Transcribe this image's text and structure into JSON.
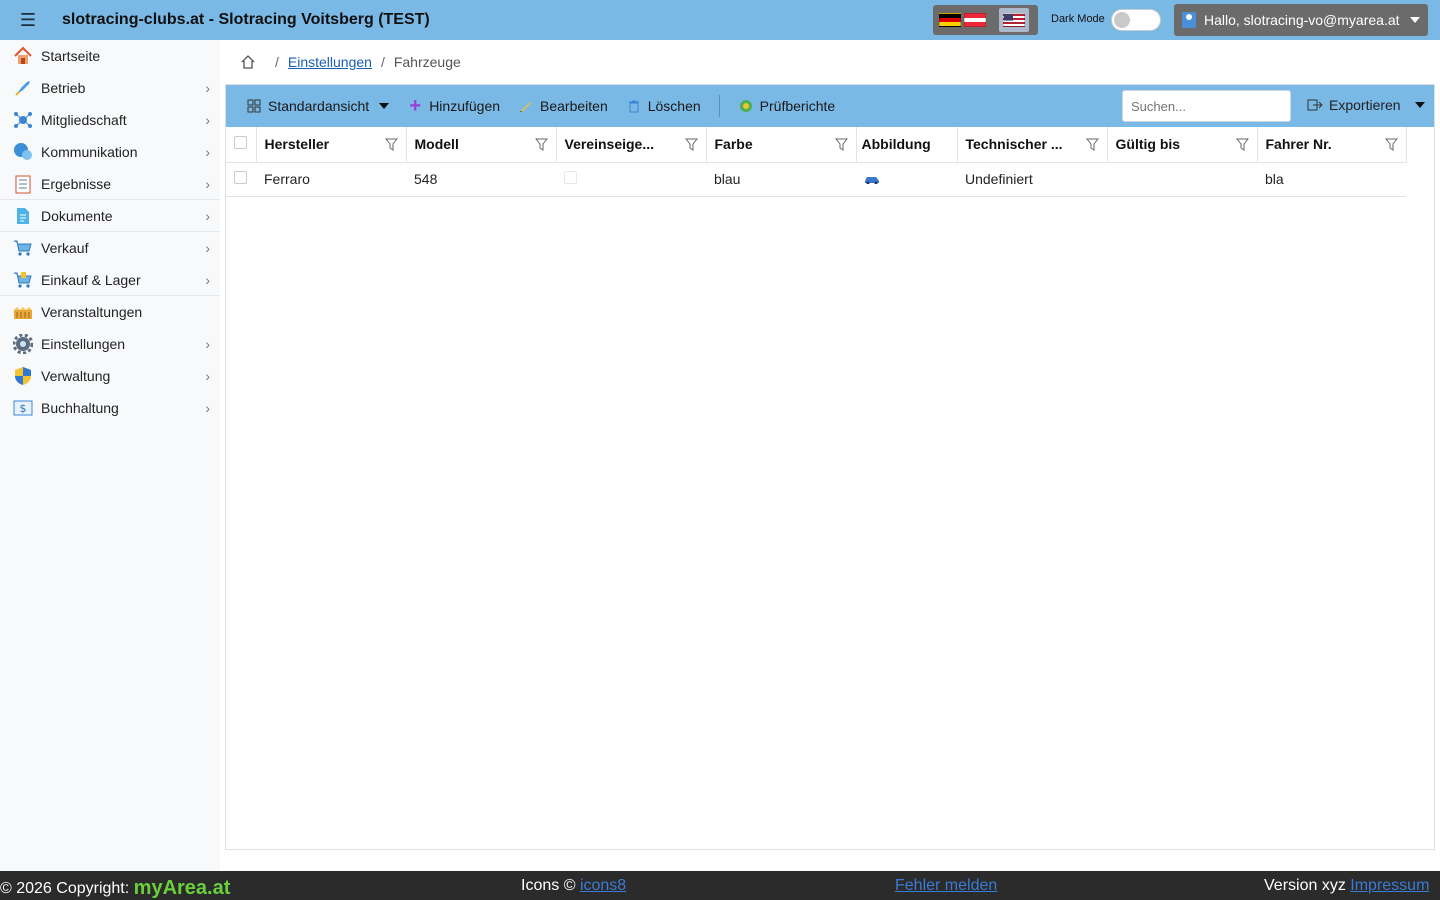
{
  "header": {
    "title": "slotracing-clubs.at - Slotracing Voitsberg (TEST)",
    "dark_mode_label": "Dark Mode",
    "user_greeting": "Hallo, slotracing-vo@myarea.at"
  },
  "sidebar": {
    "items": [
      {
        "label": "Startseite",
        "icon": "home-icon"
      },
      {
        "label": "Betrieb",
        "icon": "rocket-icon"
      },
      {
        "label": "Mitgliedschaft",
        "icon": "network-icon"
      },
      {
        "label": "Kommunikation",
        "icon": "chat-icon"
      },
      {
        "label": "Ergebnisse",
        "icon": "checklist-icon"
      },
      {
        "label": "Dokumente",
        "icon": "document-icon"
      },
      {
        "label": "Verkauf",
        "icon": "cart-icon"
      },
      {
        "label": "Einkauf & Lager",
        "icon": "basket-icon"
      },
      {
        "label": "Veranstaltungen",
        "icon": "event-icon"
      },
      {
        "label": "Einstellungen",
        "icon": "gear-icon"
      },
      {
        "label": "Verwaltung",
        "icon": "shield-icon"
      },
      {
        "label": "Buchhaltung",
        "icon": "accounting-icon"
      }
    ]
  },
  "breadcrumb": {
    "parent": "Einstellungen",
    "current": "Fahrzeuge"
  },
  "toolbar": {
    "view_label": "Standardansicht",
    "add_label": "Hinzufügen",
    "edit_label": "Bearbeiten",
    "delete_label": "Löschen",
    "reports_label": "Prüfberichte",
    "search_placeholder": "Suchen...",
    "export_label": "Exportieren"
  },
  "table": {
    "columns": [
      "Hersteller",
      "Modell",
      "Vereinseige...",
      "Farbe",
      "Abbildung",
      "Technischer ...",
      "Gültig bis",
      "Fahrer Nr."
    ],
    "rows": [
      {
        "hersteller": "Ferraro",
        "modell": "548",
        "farbe": "blau",
        "technischer": "Undefiniert",
        "gueltig_bis": "",
        "fahrer_nr": "bla"
      }
    ]
  },
  "footer": {
    "copyright": "© 2026 Copyright:",
    "brand_my": "my",
    "brand_area": "Area",
    "brand_at": ".at",
    "icons_text": "Icons ©",
    "icons_link": "icons8",
    "report_link": "Fehler melden",
    "version_text": "Version xyz",
    "impressum_link": "Impressum"
  },
  "colors": {
    "header_bg": "#7ab8e6",
    "footer_bg": "#2b2b2b",
    "brand_green": "#6ad03a",
    "link_blue": "#1a5fb4"
  }
}
